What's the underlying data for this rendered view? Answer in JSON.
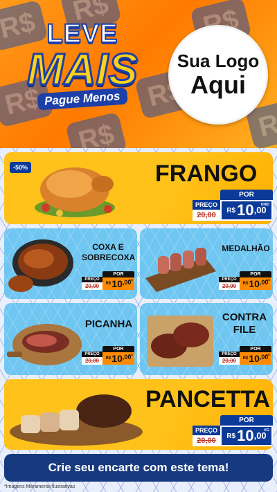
{
  "hero": {
    "tile_symbol": "R$",
    "brand_leve": "LEVE",
    "brand_mais": "MAIS",
    "brand_pague": "Pague Menos",
    "logo_line1": "Sua Logo",
    "logo_line2": "Aqui"
  },
  "colors": {
    "accent_orange": "#ff8a00",
    "brand_blue": "#0b3a99",
    "card_yellow": "#ffc21a",
    "card_blue": "#6ec6f1"
  },
  "products": {
    "frango": {
      "title": "FRANGO",
      "badge": "-50%",
      "preco_label": "PREÇO",
      "old": "20,00",
      "por": "POR",
      "currency": "R$",
      "price_int": "10",
      "price_dec": ",00",
      "unit": "UNID"
    },
    "coxa": {
      "title1": "COXA E",
      "title2": "SOBRECOXA",
      "preco_label": "PREÇO",
      "old": "20,00",
      "por": "POR",
      "currency": "R$",
      "price_int": "10",
      "price_dec": ",00",
      "unit": "KG"
    },
    "medalhao": {
      "title": "MEDALHÃO",
      "preco_label": "PREÇO",
      "old": "20,00",
      "por": "POR",
      "currency": "R$",
      "price_int": "10",
      "price_dec": ",00",
      "unit": "KG"
    },
    "picanha": {
      "title": "PICANHA",
      "preco_label": "PREÇO",
      "old": "20,00",
      "por": "POR",
      "currency": "R$",
      "price_int": "10",
      "price_dec": ",00",
      "unit": "KG"
    },
    "contrafile": {
      "title1": "CONTRA",
      "title2": "FILE",
      "preco_label": "PREÇO",
      "old": "20,00",
      "por": "POR",
      "currency": "R$",
      "price_int": "10",
      "price_dec": ",00",
      "unit": "KG"
    },
    "pancetta": {
      "title": "PANCETTA",
      "preco_label": "PREÇO",
      "old": "20,00",
      "por": "POR",
      "currency": "R$",
      "price_int": "10",
      "price_dec": ",00",
      "unit": "KG"
    }
  },
  "cta": "Crie seu encarte com este tema!",
  "disclaimer": "*Imagens Meramente Ilustrativas"
}
